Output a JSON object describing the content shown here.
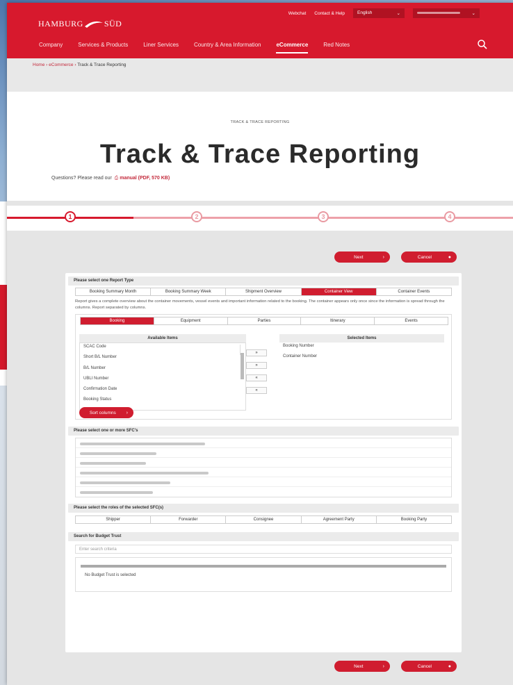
{
  "header": {
    "logo_left": "HAMBURG",
    "logo_right": "SÜD",
    "utility": [
      "Webchat",
      "Contact & Help"
    ],
    "language": "English",
    "nav": [
      "Company",
      "Services & Products",
      "Liner Services",
      "Country & Area Information",
      "eCommerce",
      "Red Notes"
    ],
    "active_nav": "eCommerce"
  },
  "breadcrumb": [
    "Home",
    "eCommerce",
    "Track & Trace Reporting"
  ],
  "hero": {
    "eyebrow": "TRACK & TRACE REPORTING",
    "title": "Track & Trace Reporting",
    "question": "Questions? Please read our",
    "manual_link": "manual (PDF, 570 KB)"
  },
  "stepper": {
    "steps": [
      "1",
      "2",
      "3",
      "4"
    ],
    "current_step": 1
  },
  "buttons": {
    "next": "Next",
    "cancel": "Cancel"
  },
  "report_type": {
    "heading": "Please select one Report Type",
    "tabs": [
      "Booking Summary Month",
      "Booking Summary Week",
      "Shipment Overview",
      "Container View",
      "Container Events"
    ],
    "active_tab": "Container View",
    "description": "Report gives a complete overview about the container movements, vessel events and important information related to the booking. The container appears only once since the information is spread through the columns. Report separated by columns."
  },
  "column_tabs": {
    "tabs": [
      "Booking",
      "Equipment",
      "Parties",
      "Itinerary",
      "Events"
    ],
    "active_tab": "Booking"
  },
  "available": {
    "heading": "Available Items",
    "items": [
      "SCAC Code",
      "Short B/L Number",
      "B/L Number",
      "UBLI Number",
      "Confirmation Date",
      "Booking Status"
    ]
  },
  "selected": {
    "heading": "Selected Items",
    "items": [
      "Booking Number",
      "Container Number"
    ]
  },
  "move_buttons": [
    "»",
    "»",
    "«",
    "«"
  ],
  "sort_button": "Sort columns",
  "sfc": {
    "heading": "Please select one or more SFC's"
  },
  "roles": {
    "heading": "Please select the roles of the selected SFC(s)",
    "items": [
      "Shipper",
      "Forwarder",
      "Consignee",
      "Agreement Party",
      "Booking Party"
    ]
  },
  "budget_trust": {
    "heading": "Search for Budget Trust",
    "placeholder": "Enter search criteria",
    "empty_text": "No Budget Trust is selected"
  },
  "colors": {
    "brand": "#d7192d",
    "button": "#d01d2f",
    "step_inactive": "#e99aa2"
  },
  "icons": [
    "search-icon",
    "chevron-down-icon",
    "pdf-icon",
    "arrow-right-icon",
    "arrow-left-icon"
  ]
}
